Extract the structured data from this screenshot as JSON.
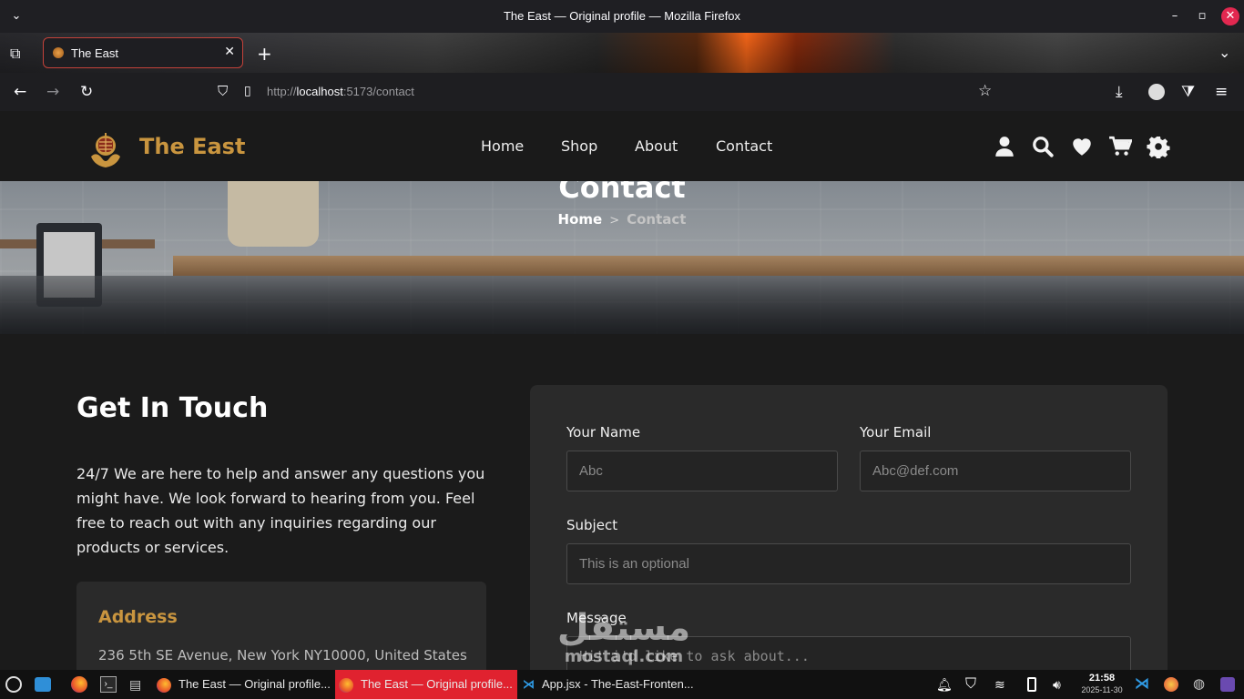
{
  "window": {
    "title": "The East — Original profile — Mozilla Firefox"
  },
  "browser": {
    "tab_title": "The East",
    "url_prefix": "http://",
    "url_host": "localhost",
    "url_rest": ":5173/contact"
  },
  "site": {
    "brand": "The East",
    "nav": [
      "Home",
      "Shop",
      "About",
      "Contact"
    ],
    "accent_color": "#c9953f",
    "header_icons": [
      "user-icon",
      "search-icon",
      "heart-icon",
      "cart-icon",
      "gear-icon"
    ]
  },
  "hero": {
    "title": "Contact",
    "breadcrumb_home": "Home",
    "breadcrumb_sep": ">",
    "breadcrumb_current": "Contact"
  },
  "contact": {
    "heading": "Get In Touch",
    "intro": "24/7 We are here to help and answer any questions you might have. We look forward to hearing from you. Feel free to reach out with any inquiries regarding our products or services.",
    "address_heading": "Address",
    "address_text": "236 5th SE Avenue, New York NY10000, United States"
  },
  "form": {
    "name_label": "Your Name",
    "name_placeholder": "Abc",
    "email_label": "Your Email",
    "email_placeholder": "Abc@def.com",
    "subject_label": "Subject",
    "subject_placeholder": "This is an optional",
    "message_label": "Message",
    "message_placeholder": "Hi! i'd like to ask about..."
  },
  "watermark": {
    "arabic": "مستقل",
    "latin": "mostaql.com"
  },
  "taskbar": {
    "items": [
      "The East — Original profile...",
      "The East — Original profile...",
      "App.jsx - The-East-Fronten..."
    ],
    "time": "21:58",
    "date": "2025-11-30"
  }
}
